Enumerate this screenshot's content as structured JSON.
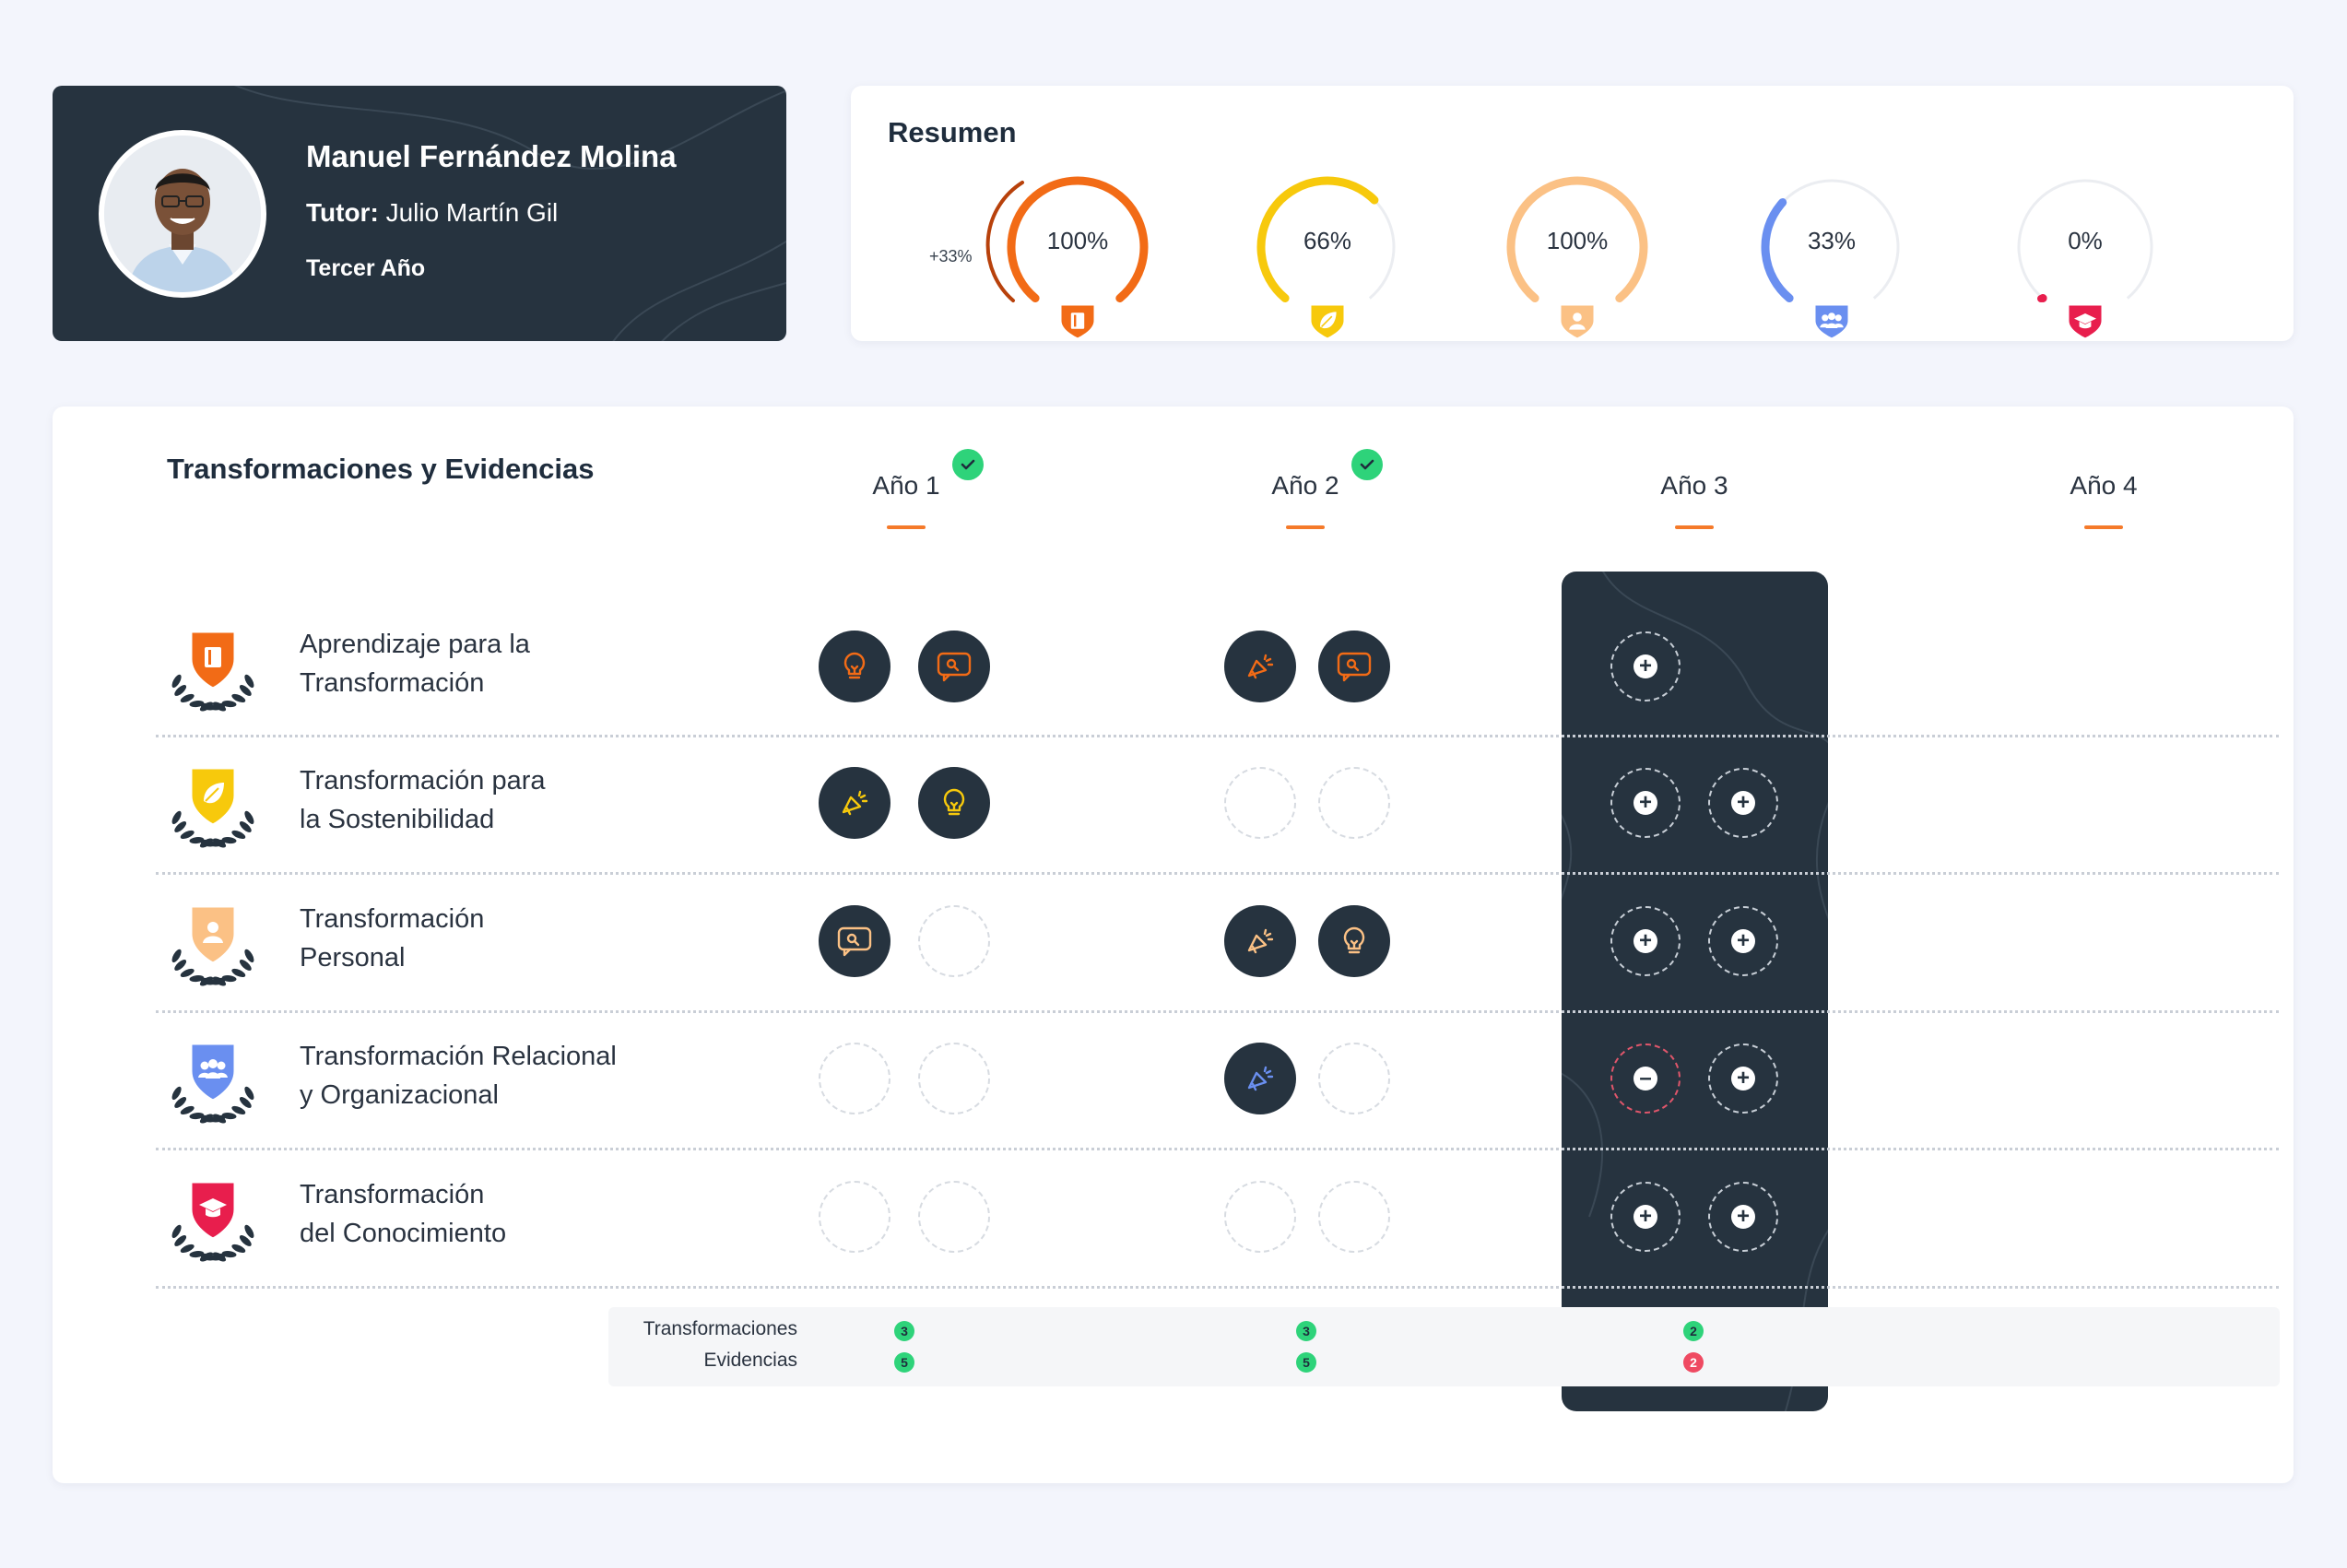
{
  "profile": {
    "name": "Manuel Fernández Molina",
    "tutor_label": "Tutor:",
    "tutor_name": "Julio Martín Gil",
    "year": "Tercer Año"
  },
  "summary": {
    "title": "Resumen",
    "bonus": "+33%",
    "gauges": [
      {
        "value": "100%",
        "fraction": 1.0,
        "color": "#f26b16",
        "icon": "book-icon"
      },
      {
        "value": "66%",
        "fraction": 0.66,
        "color": "#f7c90c",
        "icon": "leaf-icon"
      },
      {
        "value": "100%",
        "fraction": 1.0,
        "color": "#fbc185",
        "icon": "person-icon"
      },
      {
        "value": "33%",
        "fraction": 0.33,
        "color": "#6a8ff0",
        "icon": "group-icon"
      },
      {
        "value": "0%",
        "fraction": 0.0,
        "color": "#e81e4d",
        "icon": "graduation-cap-icon"
      }
    ]
  },
  "main": {
    "title": "Transformaciones y Evidencias",
    "years": [
      {
        "label": "Año 1",
        "completed": true
      },
      {
        "label": "Año 2",
        "completed": true
      },
      {
        "label": "Año 3",
        "completed": false
      },
      {
        "label": "Año 4",
        "completed": false
      }
    ],
    "rows": [
      {
        "line1": "Aprendizaje para la",
        "line2": "Transformación",
        "color": "#f26b16",
        "icon": "book-icon",
        "year1": [
          "bulb-icon",
          "comment-icon"
        ],
        "year2": [
          "megaphone-icon",
          "comment-icon"
        ],
        "year3": [
          "add"
        ]
      },
      {
        "line1": "Transformación para",
        "line2": "la Sostenibilidad",
        "color": "#f7c90c",
        "icon": "leaf-icon",
        "year1": [
          "megaphone-icon",
          "bulb-icon"
        ],
        "year2": [
          "empty",
          "empty"
        ],
        "year3": [
          "add",
          "add"
        ]
      },
      {
        "line1": "Transformación",
        "line2": "Personal",
        "color": "#fbc185",
        "icon": "person-icon",
        "year1": [
          "comment-icon",
          "empty"
        ],
        "year2": [
          "megaphone-icon",
          "bulb-icon"
        ],
        "year3": [
          "add",
          "add"
        ]
      },
      {
        "line1": "Transformación Relacional",
        "line2": "y Organizacional",
        "color": "#6a8ff0",
        "icon": "group-icon",
        "year1": [
          "empty",
          "empty"
        ],
        "year2": [
          "megaphone-icon",
          "empty"
        ],
        "year3": [
          "remove",
          "add"
        ]
      },
      {
        "line1": "Transformación",
        "line2": "del Conocimiento",
        "color": "#e81e4d",
        "icon": "graduation-cap-icon",
        "year1": [
          "empty",
          "empty"
        ],
        "year2": [
          "empty",
          "empty"
        ],
        "year3": [
          "add",
          "add"
        ]
      }
    ],
    "footer": {
      "transformaciones_label": "Transformaciones",
      "evidencias_label": "Evidencias",
      "year1": {
        "transformaciones": "3",
        "evidencias": "5"
      },
      "year2": {
        "transformaciones": "3",
        "evidencias": "5"
      },
      "year3": {
        "transformaciones": "2",
        "evidencias": "2"
      }
    }
  }
}
